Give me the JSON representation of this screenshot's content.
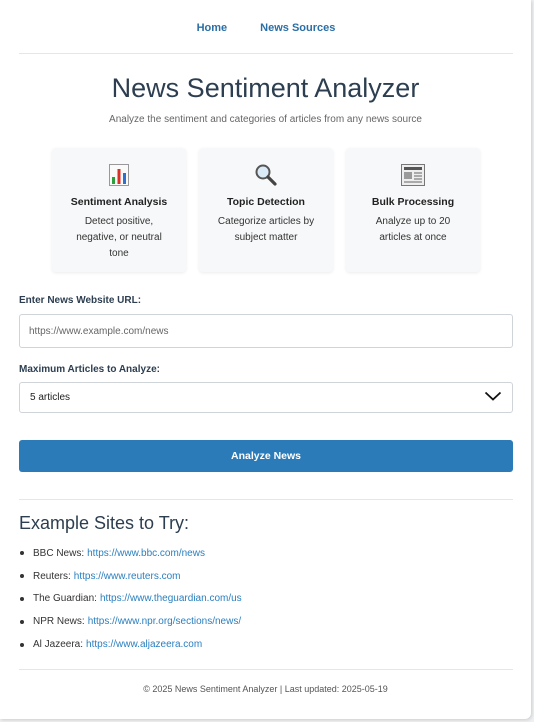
{
  "nav": {
    "home": "Home",
    "sources": "News Sources"
  },
  "header": {
    "title": "News Sentiment Analyzer",
    "subtitle": "Analyze the sentiment and categories of articles from any news source"
  },
  "features": [
    {
      "icon": "bar-chart-icon",
      "title": "Sentiment Analysis",
      "desc": "Detect positive, negative, or neutral tone"
    },
    {
      "icon": "magnifier-icon",
      "title": "Topic Detection",
      "desc": "Categorize articles by subject matter"
    },
    {
      "icon": "newspaper-icon",
      "title": "Bulk Processing",
      "desc": "Analyze up to 20 articles at once"
    }
  ],
  "form": {
    "url_label": "Enter News Website URL:",
    "url_placeholder": "https://www.example.com/news",
    "url_value": "",
    "max_label": "Maximum Articles to Analyze:",
    "max_selected": "5 articles",
    "submit_label": "Analyze News"
  },
  "examples": {
    "title": "Example Sites to Try:",
    "items": [
      {
        "name": "BBC News:",
        "url": "https://www.bbc.com/news"
      },
      {
        "name": "Reuters:",
        "url": "https://www.reuters.com"
      },
      {
        "name": "The Guardian:",
        "url": "https://www.theguardian.com/us"
      },
      {
        "name": "NPR News:",
        "url": "https://www.npr.org/sections/news/"
      },
      {
        "name": "Al Jazeera:",
        "url": "https://www.aljazeera.com"
      }
    ]
  },
  "footer": {
    "text": "© 2025 News Sentiment Analyzer | Last updated: 2025-05-19"
  },
  "colors": {
    "accent": "#2b7bb9",
    "link": "#2a7fbf",
    "heading": "#2c3e50"
  }
}
